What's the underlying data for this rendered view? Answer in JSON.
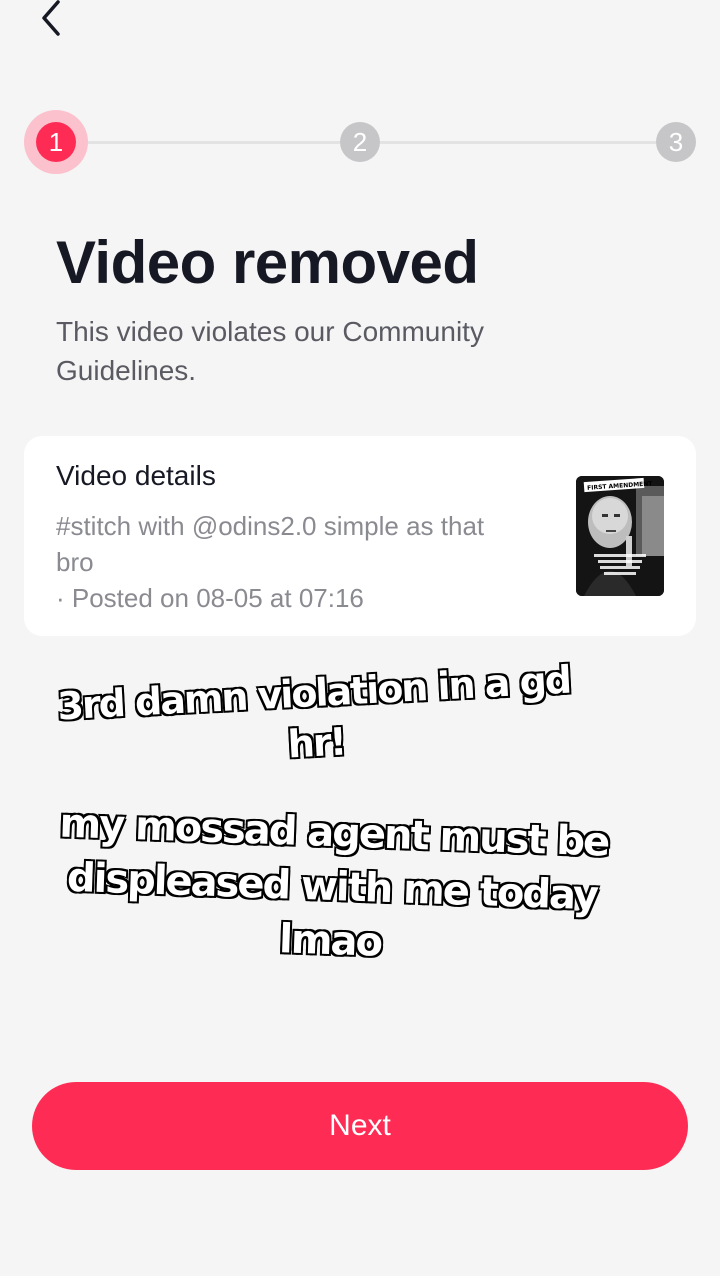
{
  "header": {
    "back_icon": "chevron-left-icon"
  },
  "stepper": {
    "steps": [
      "1",
      "2",
      "3"
    ],
    "current_step": 1,
    "colors": {
      "active": "#fe2c55",
      "inactive": "#c6c6c8",
      "halo": "#fbc2cd"
    }
  },
  "main": {
    "title": "Video removed",
    "subtitle": "This video violates our Community Guidelines."
  },
  "details_card": {
    "title": "Video details",
    "description": "#stitch with @odins2.0 simple as that bro",
    "posted": "· Posted on 08-05 at 07:16",
    "thumbnail_caption": "FIRST AMENDMENT"
  },
  "overlay": {
    "line1": "3rd damn violation in a gd",
    "line2": "hr!",
    "line3": "my mossad agent must be",
    "line4": "displeased with me today",
    "line5": "lmao"
  },
  "footer": {
    "next_label": "Next",
    "accent": "#fe2c55"
  }
}
